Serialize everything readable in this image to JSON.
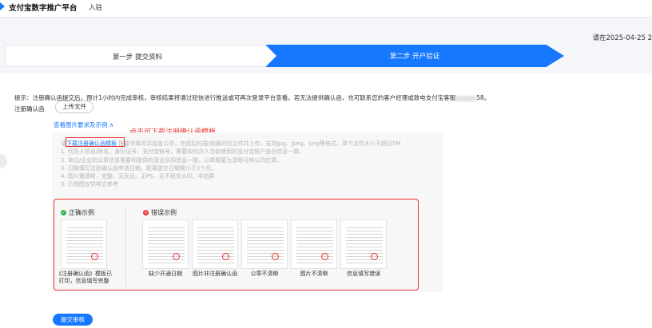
{
  "header": {
    "title": "支付宝数字推广平台",
    "subtitle": "入驻"
  },
  "deadline": "请在2025-04-25 2",
  "steps": [
    {
      "label": "第一步 提交资料"
    },
    {
      "label": "第二步 开户验证"
    }
  ],
  "tip": {
    "prefix": "提示：注册确认函提交后，预计1小时内完成审核，审核结果将通过短信进行推送或可再次登录平台查看。若无法提供确认函，也可联系您的客户经理或致电支付宝客服",
    "suffix": "58。"
  },
  "form": {
    "label": "注册确认函",
    "upload_label": "上传文件",
    "view_link": "查看图片要求及示例 ∧"
  },
  "annotation": "点击可下载注册确认函模板",
  "requirements": {
    "lead_prefix": "请",
    "download_link": "下载注册确认函模板",
    "lead_rest": "按要求填写并加盖公章，完成后扫描/拍摄对应文件并上传，支持jpg、jpeg、png等格式，单个文件大小不超过5M",
    "items": [
      "1. 代办人信息/姓名、身份证号、支付宝账号，需要和代办人当前使用的支付宝账户身份信息一致。",
      "2. 单位/企业的公章信息需要和提供的营业执照信息一致，公章需要为清晰可辨认的红章。",
      "3. 日期填写注册确认函申请日期，距离提交日期需小于3个月。",
      "4. 图片需清晰、完整、无反光、无PS、无不相关水印、非拍屏",
      "5. 示例图仅供样式参考"
    ]
  },
  "examples": {
    "correct_title": "正确示例",
    "wrong_title": "错误示例",
    "correct": [
      {
        "caption": "《注册确认函》模板已打印，信息填写完整"
      }
    ],
    "wrong": [
      {
        "caption": "缺少开通日期"
      },
      {
        "caption": "图片非注册确认函"
      },
      {
        "caption": "公章不清晰"
      },
      {
        "caption": "图片不清晰"
      },
      {
        "caption": "信息填写错误"
      }
    ]
  },
  "submit_label": "提交审核",
  "colors": {
    "primary": "#1677ff",
    "highlight": "#e8302e",
    "success": "#2fb34b"
  }
}
